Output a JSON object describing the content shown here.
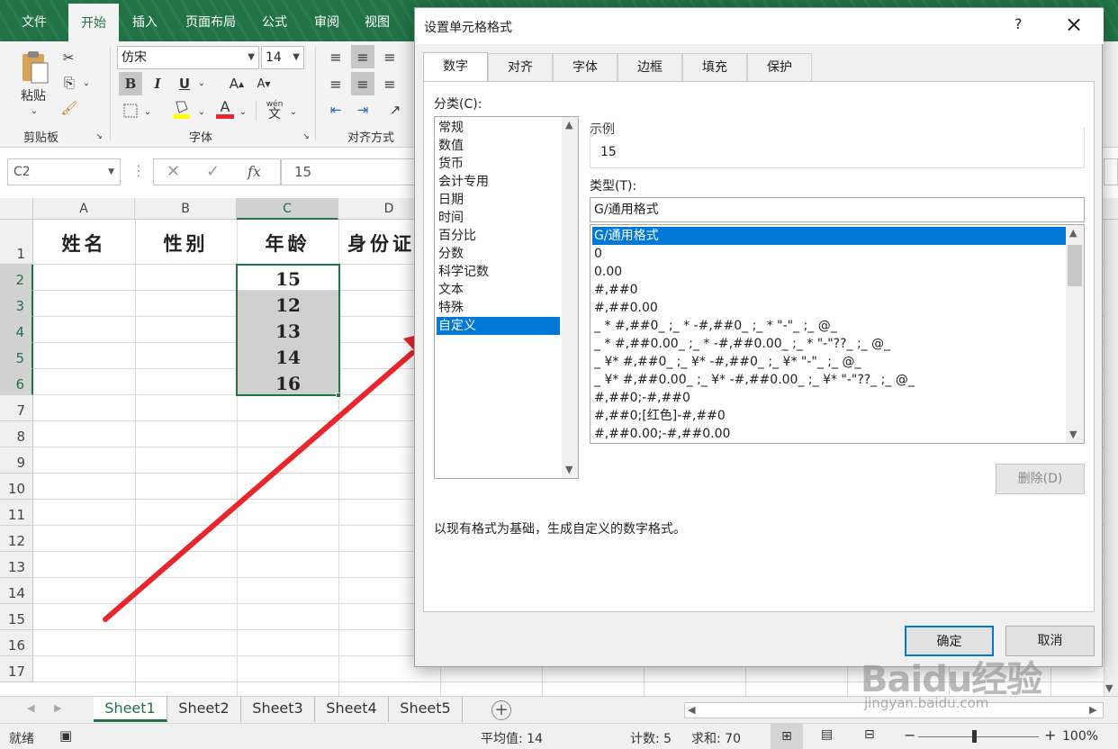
{
  "ribbon": {
    "tabs": [
      "文件",
      "开始",
      "插入",
      "页面布局",
      "公式",
      "审阅",
      "视图"
    ],
    "paste_label": "粘贴",
    "font_name": "仿宋",
    "font_size": "14",
    "bold": "B",
    "italic": "I",
    "underline": "U",
    "grow_font": "A",
    "shrink_font": "A",
    "font_color_glyph": "A",
    "wen_glyph": "wén",
    "groups": [
      "剪贴板",
      "字体",
      "对齐方式"
    ]
  },
  "formula_bar": {
    "name_box": "C2",
    "fx": "fx",
    "value": "15"
  },
  "sheet": {
    "columns": [
      "A",
      "B",
      "C",
      "D"
    ],
    "rows": [
      "1",
      "2",
      "3",
      "4",
      "5",
      "6",
      "7",
      "8",
      "9",
      "10",
      "11",
      "12",
      "13",
      "14",
      "15",
      "16",
      "17"
    ],
    "headers": [
      "姓名",
      "性别",
      "年龄",
      "身份证"
    ],
    "ages": [
      "15",
      "12",
      "13",
      "14",
      "16"
    ]
  },
  "sheet_tabs": [
    "Sheet1",
    "Sheet2",
    "Sheet3",
    "Sheet4",
    "Sheet5"
  ],
  "add_sheet": "+",
  "status": {
    "mode": "就绪",
    "average": "平均值: 14",
    "count": "计数: 5",
    "sum": "求和: 70",
    "zoom": "100%",
    "zoom_minus": "−",
    "zoom_plus": "+"
  },
  "dialog": {
    "title": "设置单元格格式",
    "help": "?",
    "close": "×",
    "tabs": [
      "数字",
      "对齐",
      "字体",
      "边框",
      "填充",
      "保护"
    ],
    "category_label": "分类(C):",
    "categories": [
      "常规",
      "数值",
      "货币",
      "会计专用",
      "日期",
      "时间",
      "百分比",
      "分数",
      "科学记数",
      "文本",
      "特殊",
      "自定义"
    ],
    "selected_category": "自定义",
    "sample_label": "示例",
    "sample_value": "15",
    "type_label": "类型(T):",
    "type_value": "G/通用格式",
    "formats": [
      "G/通用格式",
      "0",
      "0.00",
      "#,##0",
      "#,##0.00",
      "_ * #,##0_ ;_ * -#,##0_ ;_ * \"-\"_ ;_ @_",
      "_ * #,##0.00_ ;_ * -#,##0.00_ ;_ * \"-\"??_ ;_ @_",
      "_ ¥* #,##0_ ;_ ¥* -#,##0_ ;_ ¥* \"-\"_ ;_ @_",
      "_ ¥* #,##0.00_ ;_ ¥* -#,##0.00_ ;_ ¥* \"-\"??_ ;_ @_",
      "#,##0;-#,##0",
      "#,##0;[红色]-#,##0",
      "#,##0.00;-#,##0.00"
    ],
    "delete_button": "删除(D)",
    "description": "以现有格式为基础，生成自定义的数字格式。",
    "ok_button": "确定",
    "cancel_button": "取消"
  },
  "watermark": {
    "brand": "Baidu经验",
    "url": "jingyan.baidu.com"
  },
  "colors": {
    "excel_green": "#217346",
    "select_blue": "#0078d7",
    "arrow_red": "#e8262d"
  }
}
